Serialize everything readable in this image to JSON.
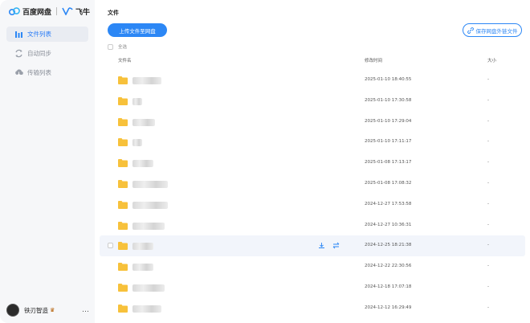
{
  "brand": {
    "name": "百度网盘",
    "partner": "飞牛"
  },
  "sidebar": {
    "items": [
      {
        "label": "文件列表",
        "icon": "bar-chart-icon",
        "active": true
      },
      {
        "label": "自动同步",
        "icon": "sync-icon",
        "active": false
      },
      {
        "label": "传输列表",
        "icon": "cloud-transfer-icon",
        "active": false
      }
    ],
    "user": {
      "name": "铁刃智造",
      "more": "…"
    }
  },
  "main": {
    "title": "文件",
    "upload_button": "上传文件至网盘",
    "save_button": "保存网盘外链文件",
    "select_all": "全选",
    "columns": {
      "name": "文件名",
      "modified": "修改时间",
      "size": "大小"
    },
    "rows": [
      {
        "date": "2025-01-10 18:40:55",
        "size": "-"
      },
      {
        "date": "2025-01-10 17:30:58",
        "size": "-"
      },
      {
        "date": "2025-01-10 17:29:04",
        "size": "-"
      },
      {
        "date": "2025-01-10 17:11:17",
        "size": "-"
      },
      {
        "date": "2025-01-08 17:13:17",
        "size": "-"
      },
      {
        "date": "2025-01-08 17:08:32",
        "size": "-"
      },
      {
        "date": "2024-12-27 17:53:58",
        "size": "-"
      },
      {
        "date": "2024-12-27 10:36:31",
        "size": "-"
      },
      {
        "date": "2024-12-25 18:21:38",
        "size": "-"
      },
      {
        "date": "2024-12-22 22:30:56",
        "size": "-"
      },
      {
        "date": "2024-12-18 17:07:18",
        "size": "-"
      },
      {
        "date": "2024-12-12 16:29:49",
        "size": "-"
      }
    ]
  },
  "colors": {
    "accent": "#2c87f5",
    "folder": "#f7c13b",
    "sidebar_bg": "#f6f7f9"
  }
}
